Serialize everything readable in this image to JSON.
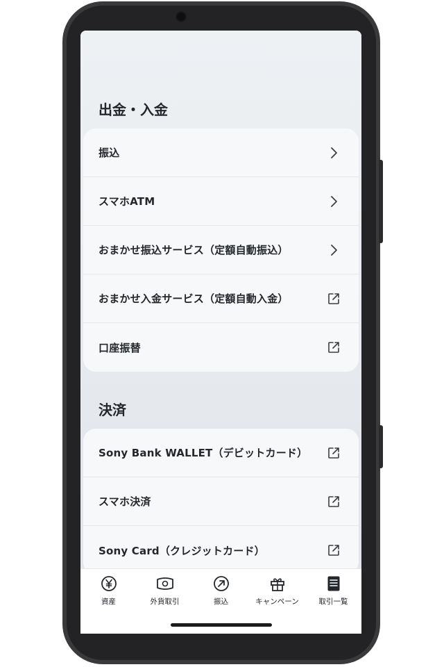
{
  "sections": {
    "deposit": {
      "title": "出金・入金",
      "items": [
        {
          "label": "振込",
          "icon": "chevron-right"
        },
        {
          "label": "スマホATM",
          "icon": "chevron-right"
        },
        {
          "label": "おまかせ振込サービス（定額自動振込）",
          "icon": "chevron-right"
        },
        {
          "label": "おまかせ入金サービス（定額自動入金）",
          "icon": "external-link"
        },
        {
          "label": "口座振替",
          "icon": "external-link"
        }
      ]
    },
    "payment": {
      "title": "決済",
      "items": [
        {
          "label": "Sony Bank WALLET（デビットカード）",
          "icon": "external-link"
        },
        {
          "label": "スマホ決済",
          "icon": "external-link"
        },
        {
          "label": "Sony Card（クレジットカード）",
          "icon": "external-link"
        }
      ]
    }
  },
  "tabbar": {
    "tabs": [
      {
        "label": "資産",
        "icon": "yen-coin-icon"
      },
      {
        "label": "外貨取引",
        "icon": "banknote-icon"
      },
      {
        "label": "振込",
        "icon": "transfer-arrow-icon"
      },
      {
        "label": "キャンペーン",
        "icon": "gift-icon"
      },
      {
        "label": "取引一覧",
        "icon": "list-document-icon"
      }
    ]
  },
  "colors": {
    "background": "#eef1f4",
    "card": "#f7f8f9",
    "text": "#23262b",
    "icon": "#3a3d42"
  }
}
